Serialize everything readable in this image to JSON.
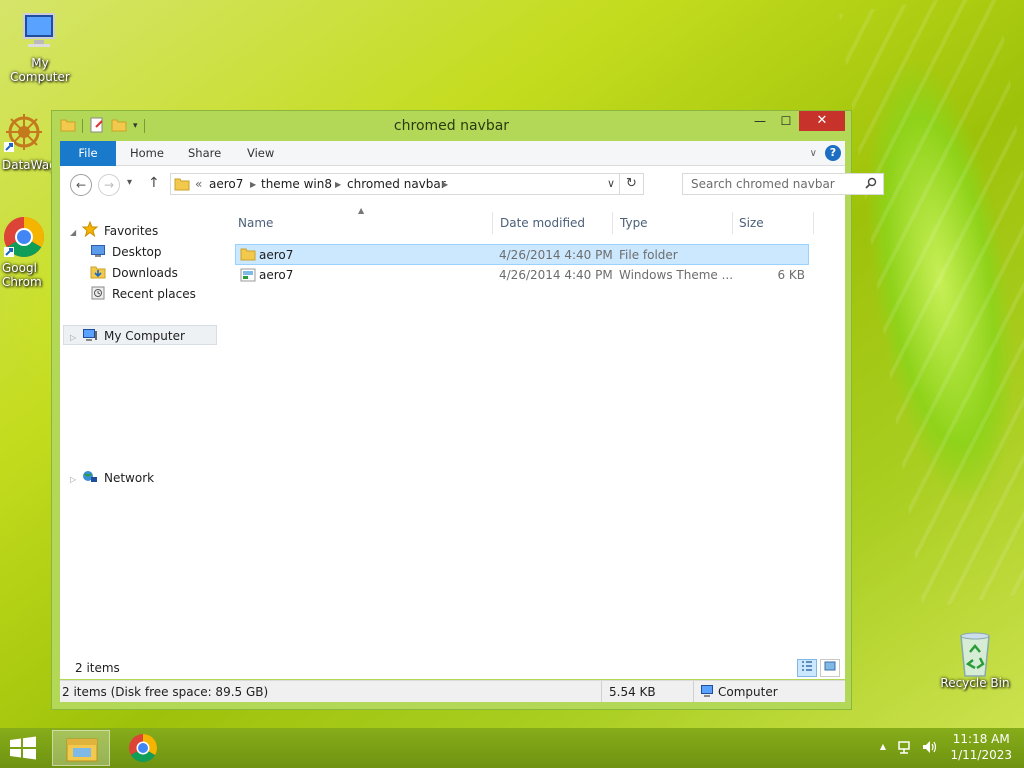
{
  "desktop": {
    "icons": [
      {
        "label": "My Computer"
      },
      {
        "label": "DataWag"
      },
      {
        "label": "Googl Chrom"
      },
      {
        "label": "Recycle Bin"
      }
    ]
  },
  "window": {
    "title": "chromed navbar",
    "close_symbol": "✕",
    "minimize_symbol": "—",
    "maximize_symbol": "☐"
  },
  "ribbon": {
    "tabs": [
      "File",
      "Home",
      "Share",
      "View"
    ],
    "help_symbol": "?"
  },
  "navigation": {
    "back_symbol": "←",
    "forward_symbol": "→",
    "up_symbol": "↑",
    "history_symbol": "▾",
    "breadcrumb_prefix": "«",
    "breadcrumbs": [
      "aero7",
      "theme win8",
      "chromed navbar"
    ],
    "refresh_symbol": "↻",
    "search_placeholder": "Search chromed navbar"
  },
  "nav_pane": {
    "favorites": "Favorites",
    "favorites_items": [
      "Desktop",
      "Downloads",
      "Recent places"
    ],
    "computer": "My Computer",
    "network": "Network"
  },
  "file_list": {
    "columns": [
      "Name",
      "Date modified",
      "Type",
      "Size"
    ],
    "rows": [
      {
        "name": "aero7",
        "date": "4/26/2014 4:40 PM",
        "type": "File folder",
        "size": "",
        "kind": "folder-icon",
        "selected": true
      },
      {
        "name": "aero7",
        "date": "4/26/2014 4:40 PM",
        "type": "Windows Theme ...",
        "size": "6 KB",
        "kind": "theme-file-icon",
        "selected": false
      }
    ],
    "item_count": "2 items"
  },
  "statusbar": {
    "summary": "2 items (Disk free space: 89.5 GB)",
    "size": "5.54 KB",
    "location": "Computer"
  },
  "taskbar": {
    "time": "11:18 AM",
    "date": "1/11/2023"
  },
  "colors": {
    "accent": "#1979ca",
    "selection": "#cce8ff",
    "window_frame": "#b3d858",
    "close_button": "#c7322a"
  }
}
